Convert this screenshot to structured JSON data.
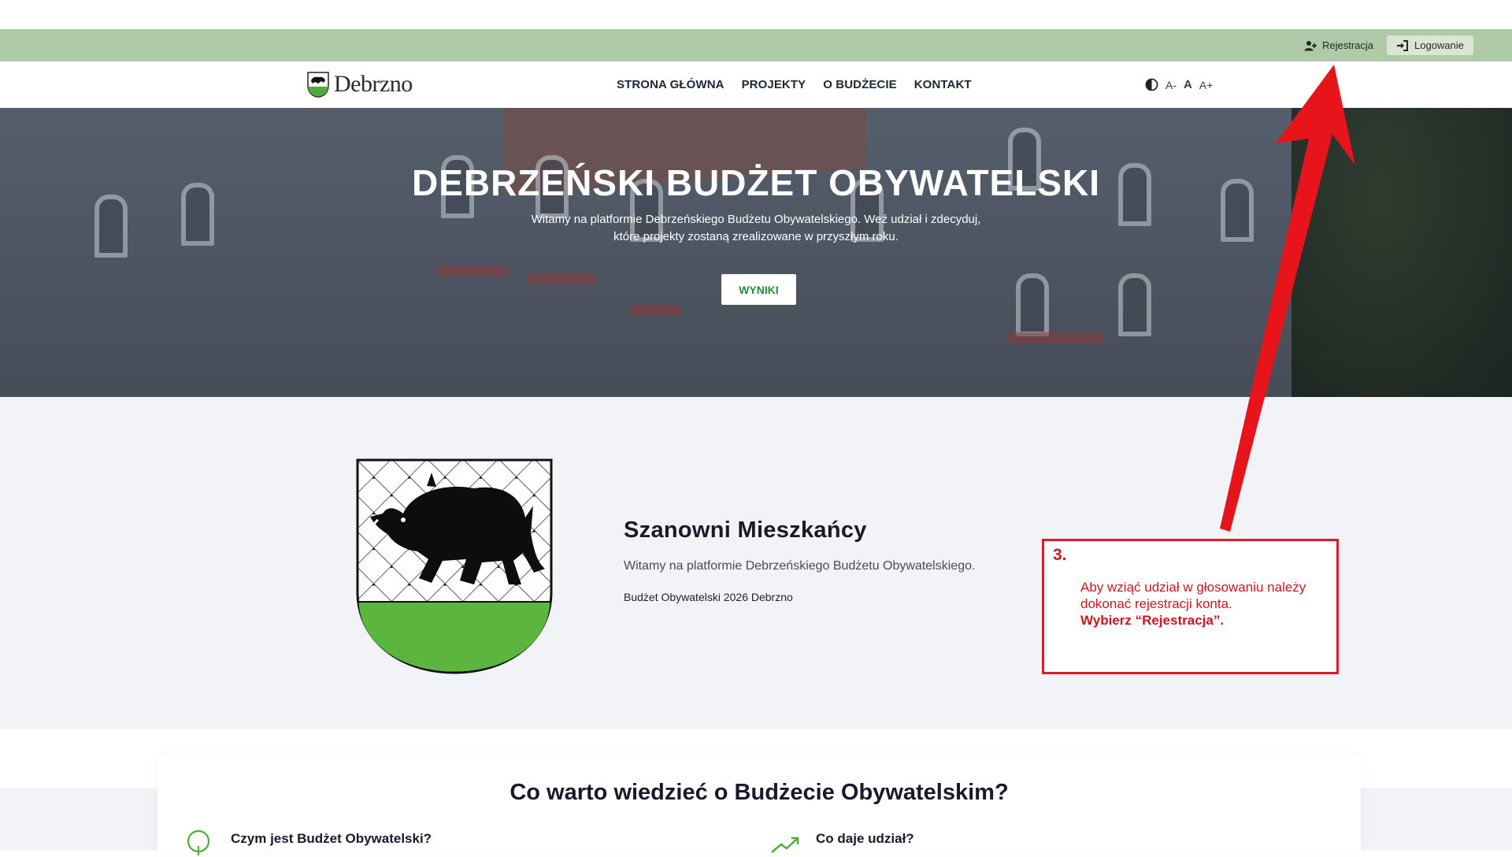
{
  "topbar": {
    "register_label": "Rejestracja",
    "login_label": "Logowanie"
  },
  "navbar": {
    "logo_text": "Debrzno",
    "menu": [
      "STRONA GŁÓWNA",
      "PROJEKTY",
      "O BUDŻECIE",
      "KONTAKT"
    ],
    "font_small": "A-",
    "font_normal": "A",
    "font_large": "A+"
  },
  "hero": {
    "title": "DEBRZEŃSKI BUDŻET OBYWATELSKI",
    "subtitle": "Witamy na platformie Debrzeńskiego Budżetu Obywatelskiego. Weź udział i zdecyduj, które projekty zostaną zrealizowane w przyszłym roku.",
    "button_label": "WYNIKI"
  },
  "welcome": {
    "title": "Szanowni Mieszkańcy",
    "text": "Witamy na platformie Debrzeńskiego Budżetu Obywatelskiego.",
    "year_text": "Budżet Obywatelski 2026 Debrzno"
  },
  "annotation": {
    "step": "3.",
    "text": "Aby wziąć udział w głosowaniu należy dokonać rejestracji konta.",
    "emphasis": "Wybierz “Rejestracja”."
  },
  "info": {
    "title": "Co warto wiedzieć o Budżecie Obywatelskim?",
    "items": [
      "Czym jest Budżet Obywatelski?",
      "Co daje udział?"
    ]
  },
  "colors": {
    "topbar": "#afcaa8",
    "accent_green": "#1f8f3a",
    "annotation_red": "#e01b24",
    "page_bg": "#f2f3f7"
  },
  "icons": [
    "user-plus-icon",
    "login-icon",
    "contrast-icon",
    "lightbulb-icon",
    "trend-up-icon"
  ]
}
